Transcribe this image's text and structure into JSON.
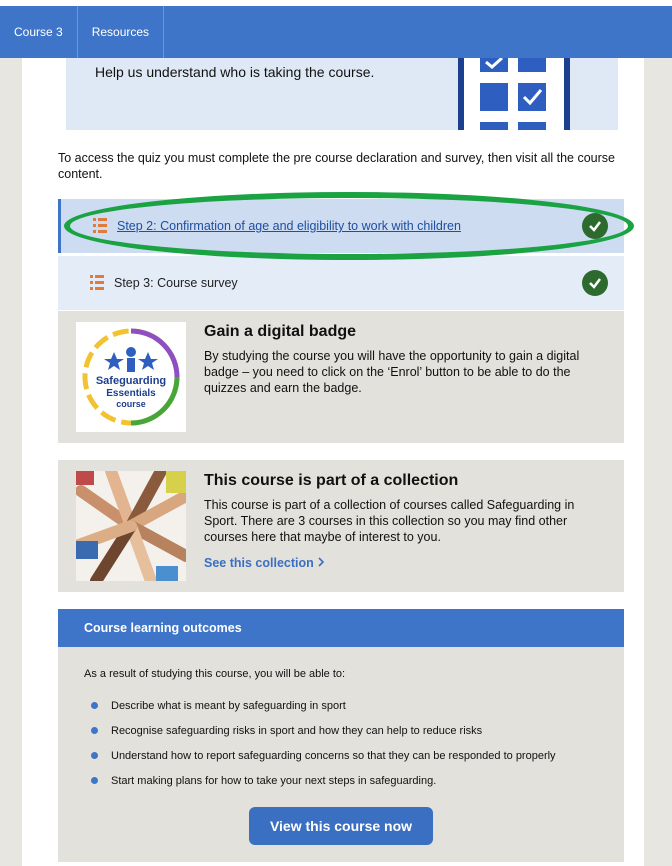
{
  "nav": {
    "tabs": [
      "Course 3",
      "Resources"
    ]
  },
  "hero": {
    "text": "Help us understand who is taking the course."
  },
  "intro": "To access the quiz you must complete the pre course declaration and survey, then visit all the course content.",
  "steps": [
    {
      "label": "Step 2: Confirmation of age and eligibility to work with children",
      "completed": true
    },
    {
      "label": "Step 3: Course survey",
      "completed": true
    }
  ],
  "badge": {
    "title": "Gain a digital badge",
    "body": "By studying the course you will have the opportunity to gain a digital badge – you need to click on the ‘Enrol’ button to be able to do the quizzes and earn the badge.",
    "image_text": [
      "Safeguarding",
      "Essentials",
      "course"
    ]
  },
  "collection": {
    "title": "This course is part of a collection",
    "body": "This course is part of a collection of courses called Safeguarding in Sport. There are 3 courses in this collection so you may find other courses here that maybe of interest to you.",
    "link": "See this collection"
  },
  "outcomes": {
    "heading": "Course learning outcomes",
    "intro": "As a result of studying this course, you will be able to:",
    "items": [
      "Describe what is meant by safeguarding in sport",
      "Recognise safeguarding risks in sport and how they can help to reduce risks",
      "Understand how to report safeguarding concerns so that they can be responded to properly",
      "Start making plans for how to take your next steps in safeguarding."
    ],
    "button": "View this course now"
  },
  "colors": {
    "accent": "#3f75c8",
    "check": "#2d6a2d",
    "highlight_ring": "#1aa243"
  }
}
